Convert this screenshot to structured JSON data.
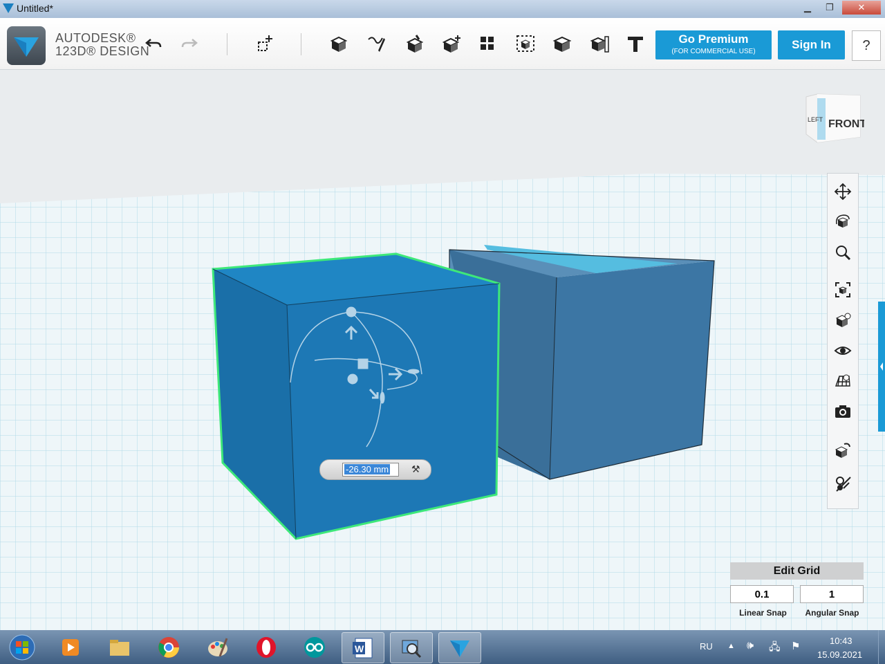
{
  "window": {
    "title": "Untitled*",
    "controls": [
      "minimize",
      "maximize",
      "close"
    ]
  },
  "brand": {
    "line1": "AUTODESK®",
    "line2": "123D® DESIGN"
  },
  "toolbar": {
    "tools": [
      "undo-icon",
      "redo-icon",
      "transform-icon",
      "primitives-icon",
      "sketch-icon",
      "construct-icon",
      "modify-icon",
      "pattern-icon",
      "grouping-icon",
      "combine-icon",
      "measure-icon",
      "text-icon"
    ],
    "premium_label": "Go Premium",
    "premium_sublabel": "(FOR COMMERCIAL USE)",
    "signin_label": "Sign In",
    "help_label": "?"
  },
  "viewcube": {
    "front": "FRONT",
    "left": "LEFT"
  },
  "navbar": {
    "tools": [
      "pan-icon",
      "orbit-icon",
      "zoom-icon",
      "fit-icon",
      "views-icon",
      "visibility-icon",
      "grid-icon",
      "camera-icon",
      "material-icon",
      "snap-icon"
    ]
  },
  "dimension": {
    "value": "-26.30 mm"
  },
  "edit_grid": {
    "title": "Edit Grid",
    "linear_value": "0.1",
    "linear_label": "Linear Snap",
    "angular_value": "1",
    "angular_label": "Angular Snap"
  },
  "taskbar": {
    "apps": [
      "start-icon",
      "media-player-icon",
      "explorer-icon",
      "chrome-icon",
      "paint-icon",
      "opera-icon",
      "arduino-icon",
      "word-icon",
      "search-tool-icon",
      "123d-design-icon"
    ],
    "lang": "RU",
    "time": "10:43",
    "date": "15.09.2021"
  },
  "colors": {
    "accent": "#1a9ad6",
    "cube_selected": "#1f78b4",
    "cube_other": "#3f7aa6",
    "selection_outline": "#3ee87a"
  }
}
